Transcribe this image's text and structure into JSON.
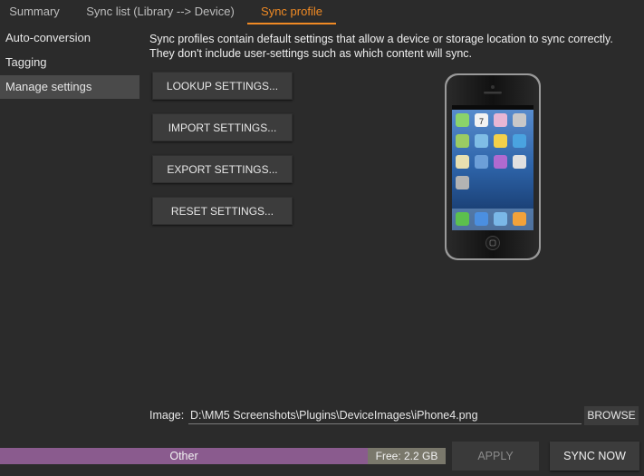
{
  "tabs": [
    {
      "label": "Summary"
    },
    {
      "label": "Sync list (Library --> Device)"
    },
    {
      "label": "Sync profile",
      "active": true
    }
  ],
  "sidebar": {
    "items": [
      {
        "label": "Auto-conversion"
      },
      {
        "label": "Tagging"
      },
      {
        "label": "Manage settings",
        "selected": true
      }
    ]
  },
  "main": {
    "description_line1": "Sync profiles contain default settings that allow a device or storage location to sync correctly.",
    "description_line2": "They don't include user-settings such as which content will sync.",
    "buttons": {
      "lookup": "LOOKUP SETTINGS...",
      "import": "IMPORT SETTINGS...",
      "export": "EXPORT SETTINGS...",
      "reset": "RESET SETTINGS..."
    },
    "device_image": "iphone-4-device",
    "calendar_day": "7",
    "image_label": "Image:",
    "image_path": "D:\\MM5 Screenshots\\Plugins\\DeviceImages\\iPhone4.png",
    "browse_label": "BROWSE"
  },
  "footer": {
    "usage": {
      "other_label": "Other",
      "free_label": "Free: 2.2 GB",
      "other_color": "#8a5b8e",
      "free_color": "#7a786b"
    },
    "apply_label": "APPLY",
    "sync_now_label": "SYNC NOW"
  },
  "colors": {
    "accent": "#f08a24",
    "background": "#2b2b2b"
  }
}
